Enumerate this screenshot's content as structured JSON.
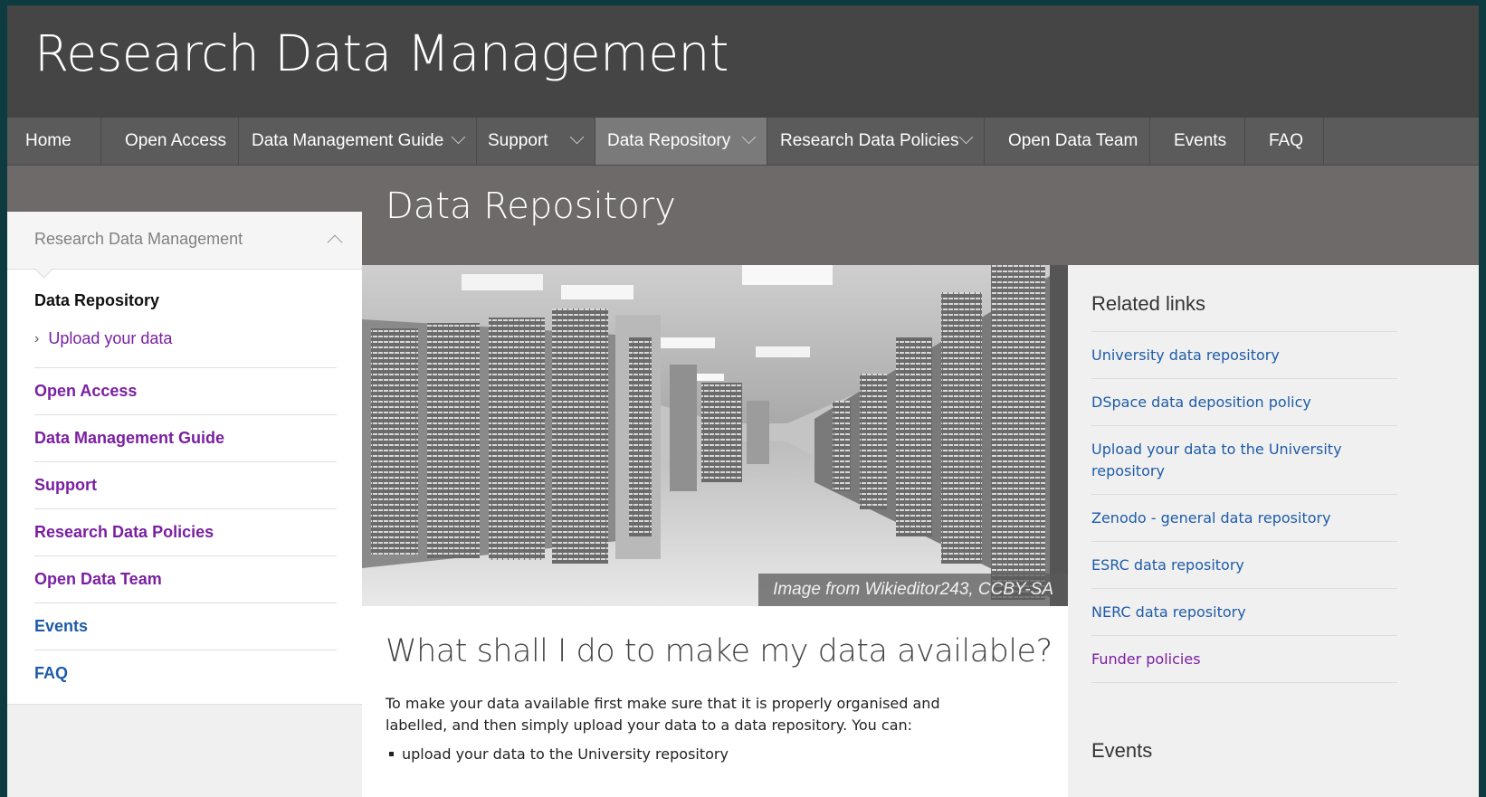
{
  "site": {
    "title": "Research Data Management"
  },
  "nav": {
    "items": [
      {
        "label": "Home"
      },
      {
        "label": "Open Access"
      },
      {
        "label": "Data Management Guide"
      },
      {
        "label": "Support"
      },
      {
        "label": "Data Repository"
      },
      {
        "label": "Research Data Policies"
      },
      {
        "label": "Open Data Team"
      },
      {
        "label": "Events"
      },
      {
        "label": "FAQ"
      }
    ],
    "active": "Data Repository",
    "chevron_icon": "chevron-down-icon"
  },
  "page": {
    "title": "Data Repository"
  },
  "sidebar": {
    "header": "Research Data Management",
    "header_icon": "chevron-up-icon",
    "current": "Data Repository",
    "sub_item": "Upload your data",
    "links": [
      {
        "label": "Open Access"
      },
      {
        "label": "Data Management Guide"
      },
      {
        "label": "Support"
      },
      {
        "label": "Research Data Policies"
      },
      {
        "label": "Open Data Team"
      },
      {
        "label": "Events"
      },
      {
        "label": "FAQ"
      }
    ]
  },
  "hero": {
    "caption": "Image from Wikieditor243, CCBY-SA"
  },
  "main": {
    "heading": "What shall I do to make my data available?",
    "paragraph": "To make your data available first make sure that it is properly organised and labelled, and then simply upload your data to a data repository. You can:",
    "list": [
      "upload your data to the University repository"
    ]
  },
  "aside": {
    "title": "Related links",
    "links": [
      {
        "label": "University data repository"
      },
      {
        "label": "DSpace data deposition policy"
      },
      {
        "label": "Upload your data to the University repository"
      },
      {
        "label": "Zenodo - general data repository"
      },
      {
        "label": "ESRC data repository"
      },
      {
        "label": "NERC data repository"
      },
      {
        "label": "Funder policies"
      }
    ],
    "events_title": "Events"
  },
  "colors": {
    "masthead": "#454545",
    "nav": "#5b5b5b",
    "nav_active": "#7a7a7a",
    "banner": "#6e6a6a",
    "link_purple": "#7a1fa2",
    "link_blue": "#1f5ca8"
  }
}
